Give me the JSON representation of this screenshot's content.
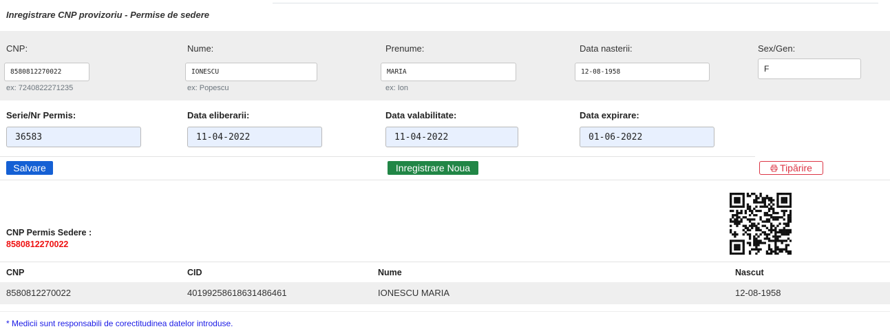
{
  "page": {
    "title": "Inregistrare CNP provizoriu - Permise de sedere"
  },
  "form": {
    "cnp": {
      "label": "CNP:",
      "value": "8580812270022",
      "hint": "ex: 7240822271235"
    },
    "nume": {
      "label": "Nume:",
      "value": "IONESCU",
      "hint": "ex: Popescu"
    },
    "prenume": {
      "label": "Prenume:",
      "value": "MARIA",
      "hint": "ex: Ion"
    },
    "data_nasterii": {
      "label": "Data nasterii:",
      "value": "12-08-1958"
    },
    "sex": {
      "label": "Sex/Gen:",
      "value": "F"
    }
  },
  "permit": {
    "serie": {
      "label": "Serie/Nr Permis:",
      "value": "36583"
    },
    "eliberare": {
      "label": "Data eliberarii:",
      "value": "11-04-2022"
    },
    "valabilitate": {
      "label": "Data valabilitate:",
      "value": "11-04-2022"
    },
    "expirare": {
      "label": "Data expirare:",
      "value": "01-06-2022"
    }
  },
  "actions": {
    "save": "Salvare",
    "new": "Inregistrare Noua",
    "print": "Tipărire",
    "print_icon": "printer-icon"
  },
  "result": {
    "label": "CNP Permis Sedere :",
    "value": "8580812270022",
    "qr_icon": "qr-code"
  },
  "table": {
    "headers": [
      "CNP",
      "CID",
      "Nume",
      "Nascut"
    ],
    "rows": [
      [
        "8580812270022",
        "40199258618631486461",
        "IONESCU MARIA",
        "12-08-1958"
      ]
    ]
  },
  "footer": {
    "note": "* Medicii sunt responsabili de corectitudinea datelor introduse."
  },
  "colors": {
    "save_button": "#1560d4",
    "new_button": "#218646",
    "print_button": "#dc3545",
    "cnp_highlight": "#ee1111",
    "note_text": "#1a1ae6"
  }
}
